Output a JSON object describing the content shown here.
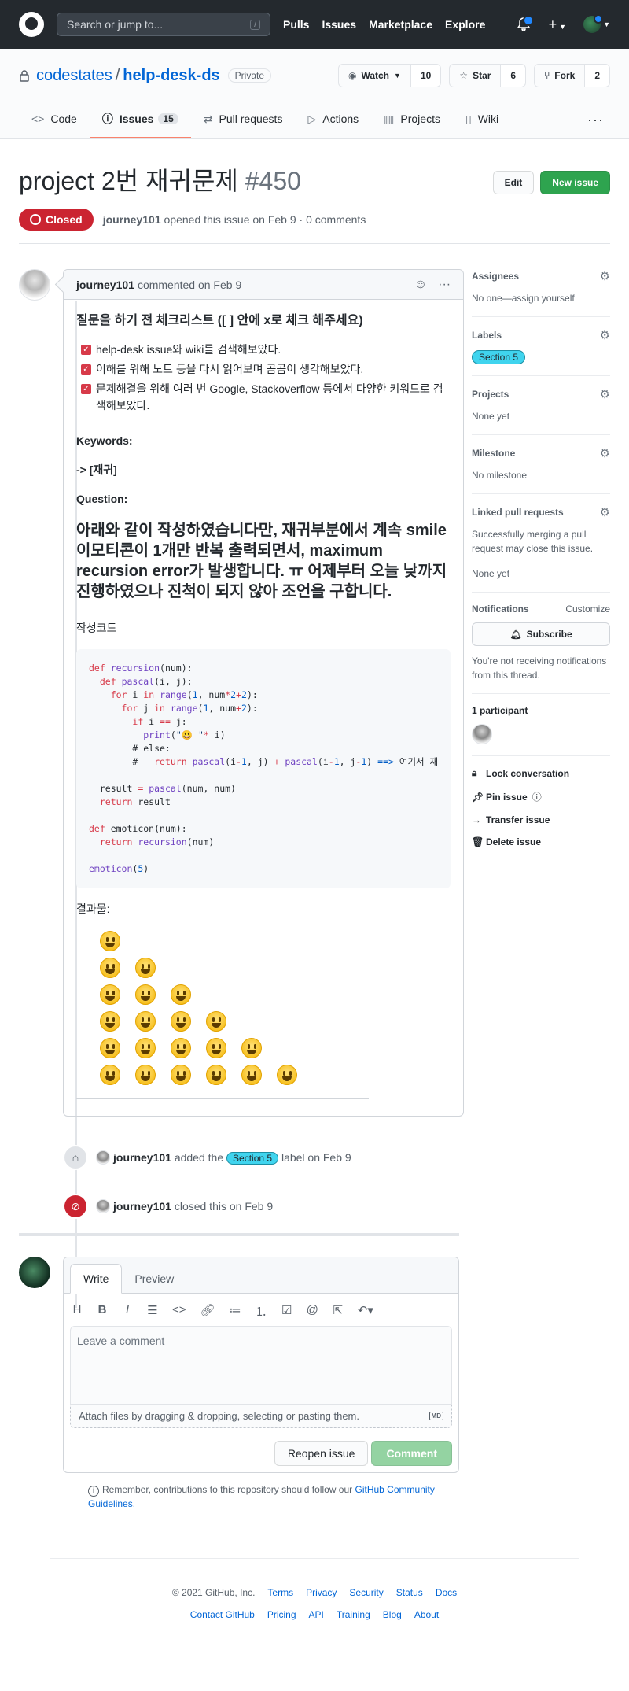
{
  "header": {
    "search_placeholder": "Search or jump to...",
    "search_key": "/",
    "nav": [
      "Pulls",
      "Issues",
      "Marketplace",
      "Explore"
    ]
  },
  "repo": {
    "owner": "codestates",
    "name": "help-desk-ds",
    "visibility": "Private",
    "watch_label": "Watch",
    "watch_count": "10",
    "star_label": "Star",
    "star_count": "6",
    "fork_label": "Fork",
    "fork_count": "2"
  },
  "tabs": [
    {
      "label": "Code"
    },
    {
      "label": "Issues",
      "count": "15"
    },
    {
      "label": "Pull requests"
    },
    {
      "label": "Actions"
    },
    {
      "label": "Projects"
    },
    {
      "label": "Wiki"
    }
  ],
  "issue": {
    "title": "project 2번 재귀문제",
    "number": "#450",
    "edit_label": "Edit",
    "new_issue_label": "New issue",
    "state": "Closed",
    "author": "journey101",
    "meta": "opened this issue on Feb 9 · 0 comments"
  },
  "comment": {
    "author": "journey101",
    "date": "commented on Feb 9",
    "heading": "질문을 하기 전 체크리스트 ([ ] 안에 x로 체크 해주세요)",
    "tasks": [
      "help-desk issue와 wiki를 검색해보았다.",
      "이해를 위해 노트 등을 다시 읽어보며 곰곰이 생각해보았다.",
      "문제해결을 위해 여러 번 Google, Stackoverflow 등에서 다양한 키워드로 검색해보았다."
    ],
    "keywords_label": "Keywords:",
    "keywords_value": "-> [재귀]",
    "question_label": "Question:",
    "question_text": "아래와 같이 작성하였습니다만, 재귀부분에서 계속 smile 이모티콘이 1개만 반복 출력되면서, maximum recursion error가 발생합니다. ㅠ 어제부터 오늘 낮까지 진행하였으나 진척이 되지 않아 조언을 구합니다.",
    "code_label": "작성코드",
    "code_lines": [
      "def recursion(num):",
      "  def pascal(i, j):",
      "    for i in range(1, num*2+2):",
      "      for j in range(1, num+2):",
      "        if i == j:",
      "          print(\"😃 \"* i)",
      "        # else:",
      "        #   return pascal(i-1, j) + pascal(i-1, j-1) ==> 여기서 재",
      "",
      "  result = pascal(num, num)",
      "  return result",
      "",
      "def emoticon(num):",
      "  return recursion(num)",
      "",
      "emoticon(5)"
    ],
    "result_label": "결과물:",
    "emoji_rows": [
      1,
      2,
      3,
      4,
      5,
      6
    ]
  },
  "events": {
    "label_event": {
      "author": "journey101",
      "text_before": "added the",
      "label": "Section 5",
      "text_after": "label on Feb 9"
    },
    "close_event": {
      "author": "journey101",
      "text": "closed this on Feb 9"
    }
  },
  "form": {
    "write_tab": "Write",
    "preview_tab": "Preview",
    "placeholder": "Leave a comment",
    "attach_text": "Attach files by dragging & dropping, selecting or pasting them.",
    "markdown_badge": "MD",
    "reopen_label": "Reopen issue",
    "comment_label": "Comment",
    "remember_text": "Remember, contributions to this repository should follow our",
    "guidelines_link": "GitHub Community Guidelines."
  },
  "sidebar": {
    "assignees_title": "Assignees",
    "assignees_value": "No one—assign yourself",
    "labels_title": "Labels",
    "label_value": "Section 5",
    "projects_title": "Projects",
    "projects_value": "None yet",
    "milestone_title": "Milestone",
    "milestone_value": "No milestone",
    "linked_title": "Linked pull requests",
    "linked_desc": "Successfully merging a pull request may close this issue.",
    "linked_value": "None yet",
    "notifications_title": "Notifications",
    "customize": "Customize",
    "subscribe": "Subscribe",
    "notif_desc": "You're not receiving notifications from this thread.",
    "participants": "1 participant",
    "lock": "Lock conversation",
    "pin": "Pin issue",
    "transfer": "Transfer issue",
    "delete": "Delete issue"
  },
  "footer": {
    "copyright": "© 2021 GitHub, Inc.",
    "row1": [
      "Terms",
      "Privacy",
      "Security",
      "Status",
      "Docs"
    ],
    "row2": [
      "Contact GitHub",
      "Pricing",
      "API",
      "Training",
      "Blog",
      "About"
    ]
  },
  "colors": {
    "closed": "#cb2431",
    "label": "#40d4ee",
    "primary": "#2ea44f",
    "link": "#0366d6"
  }
}
